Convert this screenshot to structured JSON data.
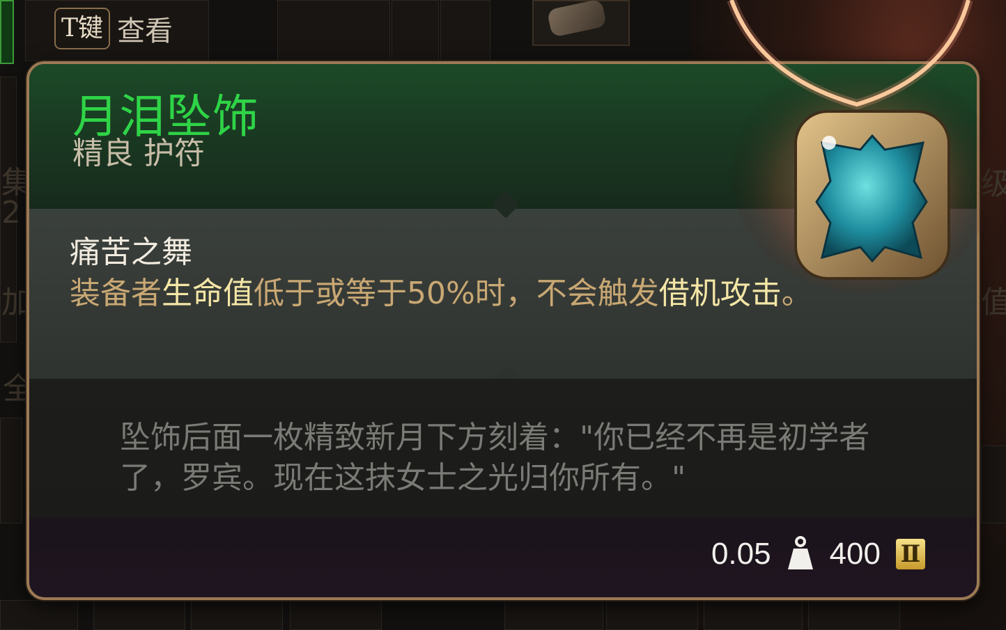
{
  "hint": {
    "key": "T键",
    "label": "查看"
  },
  "item": {
    "name": "月泪坠饰",
    "type": "精良 护符"
  },
  "effect": {
    "title": "痛苦之舞",
    "desc_parts": {
      "p1": "装备者",
      "p2": "生命值",
      "p3": "低于或等于50%时，不会触发",
      "p4": "借机攻击",
      "p5": "。"
    }
  },
  "flavor": "坠饰后面一枚精致新月下方刻着：\"你已经不再是初学者了，罗宾。现在这抹女士之光归你所有。\"",
  "footer": {
    "weight": "0.05",
    "weight_icon": "weight-icon",
    "gold": "400",
    "gold_icon": "gold-coin-icon"
  },
  "background_glyphs": {
    "g1": "集",
    "g2": "2",
    "g3": "加",
    "g4": "全",
    "g5": "级",
    "g6": "值"
  },
  "colors": {
    "name": "#2fd447",
    "highlight": "#f4e6a6",
    "effect_text": "#c9a874",
    "flavor_text": "#7a7a76",
    "border": "#9c7a55"
  }
}
